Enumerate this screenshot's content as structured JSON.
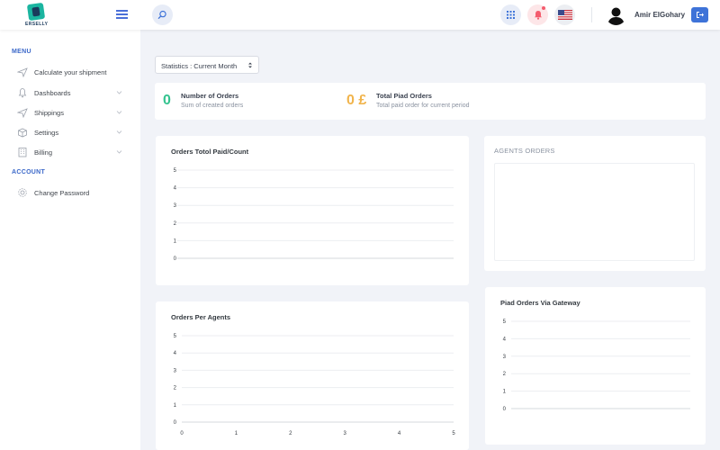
{
  "brand": {
    "logo_text": "ERSELLY",
    "accent": "#3e73d8",
    "teal": "#1bb5a0"
  },
  "topbar": {
    "user_name": "Amir ElGohary",
    "icons": [
      "menu-icon",
      "search-icon",
      "apps-grid-icon",
      "bell-icon",
      "us-flag-icon",
      "logout-icon"
    ]
  },
  "sidebar": {
    "menu_title": "MENU",
    "items": [
      {
        "label": "Calculate your shipment",
        "icon": "plane-icon",
        "expandable": false
      },
      {
        "label": "Dashboards",
        "icon": "bell-icon",
        "expandable": true
      },
      {
        "label": "Shippings",
        "icon": "plane-icon",
        "expandable": true
      },
      {
        "label": "Settings",
        "icon": "box-icon",
        "expandable": true
      },
      {
        "label": "Billing",
        "icon": "building-icon",
        "expandable": true
      }
    ],
    "account_title": "ACCOUNT",
    "account_items": [
      {
        "label": "Change Password",
        "icon": "gear-icon"
      }
    ]
  },
  "filter": {
    "selected": "Statistics : Current Month"
  },
  "summary": {
    "orders": {
      "value": "0",
      "title": "Number of Orders",
      "subtitle": "Sum of created orders",
      "color": "#34c38f"
    },
    "paid": {
      "value": "0 £",
      "title": "Total Piad Orders",
      "subtitle": "Total paid order for current period",
      "color": "#f1b44c"
    }
  },
  "cards": {
    "orders_total": {
      "title": "Orders Totol Paid/Count"
    },
    "agents_orders": {
      "title": "AGENTS ORDERS"
    },
    "orders_per_agents": {
      "title": "Orders Per Agents"
    },
    "paid_via_gateway": {
      "title": "Piad Orders Via Gateway"
    }
  },
  "chart_data": [
    {
      "type": "line",
      "title": "Orders Totol Paid/Count",
      "ylim": [
        0,
        5
      ],
      "yticks": [
        0,
        1,
        2,
        3,
        4,
        5
      ],
      "series": []
    },
    {
      "type": "bar",
      "title": "Orders Per Agents",
      "ylim": [
        0,
        5
      ],
      "yticks": [
        0,
        1,
        2,
        3,
        4,
        5
      ],
      "xlim": [
        0,
        5
      ],
      "xticks": [
        0,
        1,
        2,
        3,
        4,
        5
      ],
      "series": []
    },
    {
      "type": "line",
      "title": "Piad Orders Via Gateway",
      "ylim": [
        0,
        5
      ],
      "yticks": [
        0,
        1,
        2,
        3,
        4,
        5
      ],
      "series": []
    }
  ]
}
